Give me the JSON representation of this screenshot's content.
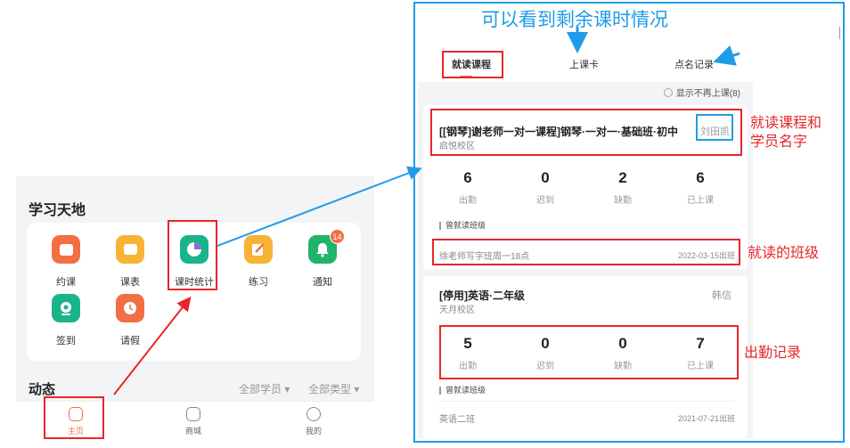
{
  "caption": "可以看到剩余课时情况",
  "study": {
    "title": "学习天地",
    "items": [
      {
        "label": "约课",
        "icon": "calendar-book-icon"
      },
      {
        "label": "课表",
        "icon": "timetable-icon"
      },
      {
        "label": "课时统计",
        "icon": "pie-stats-icon"
      },
      {
        "label": "练习",
        "icon": "practice-icon"
      },
      {
        "label": "通知",
        "icon": "bell-icon",
        "badge": "14"
      },
      {
        "label": "签到",
        "icon": "location-pin-icon"
      },
      {
        "label": "请假",
        "icon": "leave-icon"
      }
    ]
  },
  "dynamics": {
    "title": "动态",
    "filter_students": "全部学员 ▾",
    "filter_types": "全部类型 ▾"
  },
  "tabbar": [
    {
      "label": "主页",
      "icon": "home-icon",
      "active": true
    },
    {
      "label": "商城",
      "icon": "shop-icon",
      "active": false
    },
    {
      "label": "我的",
      "icon": "profile-icon",
      "active": false
    }
  ],
  "records": {
    "tabs": [
      "就读课程",
      "上课卡",
      "点名记录"
    ],
    "hide_label": "显示不再上课(8)",
    "courses": [
      {
        "title": "[[钢琴]谢老师一对一课程]钢琴·一对一·基础班·初中",
        "campus": "启悦校区",
        "student": "刘田凯",
        "stats": [
          {
            "value": "6",
            "label": "出勤"
          },
          {
            "value": "0",
            "label": "迟到"
          },
          {
            "value": "2",
            "label": "缺勤"
          },
          {
            "value": "6",
            "label": "已上课"
          }
        ],
        "section": "曾就读班级",
        "class_name": "徐老师写字班周一18点",
        "class_date": "2022-03-15出班"
      },
      {
        "title": "[停用]英语·二年级",
        "campus": "天月校区",
        "student": "韩信",
        "stats": [
          {
            "value": "5",
            "label": "出勤"
          },
          {
            "value": "0",
            "label": "迟到"
          },
          {
            "value": "0",
            "label": "缺勤"
          },
          {
            "value": "7",
            "label": "已上课"
          }
        ],
        "section": "曾就读班级",
        "class_name": "英语二班",
        "class_date": "2021-07-21出班"
      }
    ]
  },
  "annotations": {
    "course_and_name": [
      "就读课程和",
      "学员名字"
    ],
    "class": "就读的班级",
    "attendance": "出勤记录"
  },
  "colors": {
    "accent": "#f26f43",
    "annotation_red": "#e8262a",
    "annotation_blue": "#1f9be8"
  }
}
